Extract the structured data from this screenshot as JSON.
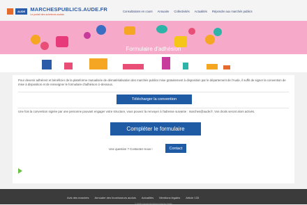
{
  "header": {
    "logo_box": "AUDE",
    "logo_main": "MARCHESPUBLICS.AUDE.FR",
    "logo_sub": "Le portail des acheteurs audois",
    "nav": [
      "Consultations en cours",
      "Annuaire",
      "Collectivités",
      "Actualités",
      "Répondre aux marchés publics"
    ]
  },
  "banner": {
    "title": "Formulaire d'adhésion"
  },
  "content": {
    "intro": "Pour devenir adhérent et bénéficier de la plateforme mutualisée de dématérialisation des marchés publics mise gratuitement à disposition par le département de l'Aude, il suffit de signer la convention de mise à disposition et de renseigner le formulaire d'adhésion ci-dessous.",
    "download_button": "Télécharger la convention",
    "after_sign": "Une fois la convention signée par une personne pouvant engager votre structure, vous pouvez la renvoyer à l'adresse suivante : marches@aude.fr. Vos droits seront alors activés.",
    "complete_button": "Compléter le formulaire",
    "question": "Une question ? Contactez-nous !",
    "contact_button": "Contact"
  },
  "footer": {
    "links": [
      "Avis des marchés",
      "Annuaire des fournisseurs audois",
      "Actualités",
      "Mentions légales",
      "Article 133"
    ],
    "copyright": "© 2015 Conseil départemental de l'Aude"
  },
  "colors": {
    "brand_blue": "#1f5aa5",
    "banner_pink": "#f6a9c8",
    "footer": "#3b3b3b",
    "accent_green": "#6cc04a"
  }
}
